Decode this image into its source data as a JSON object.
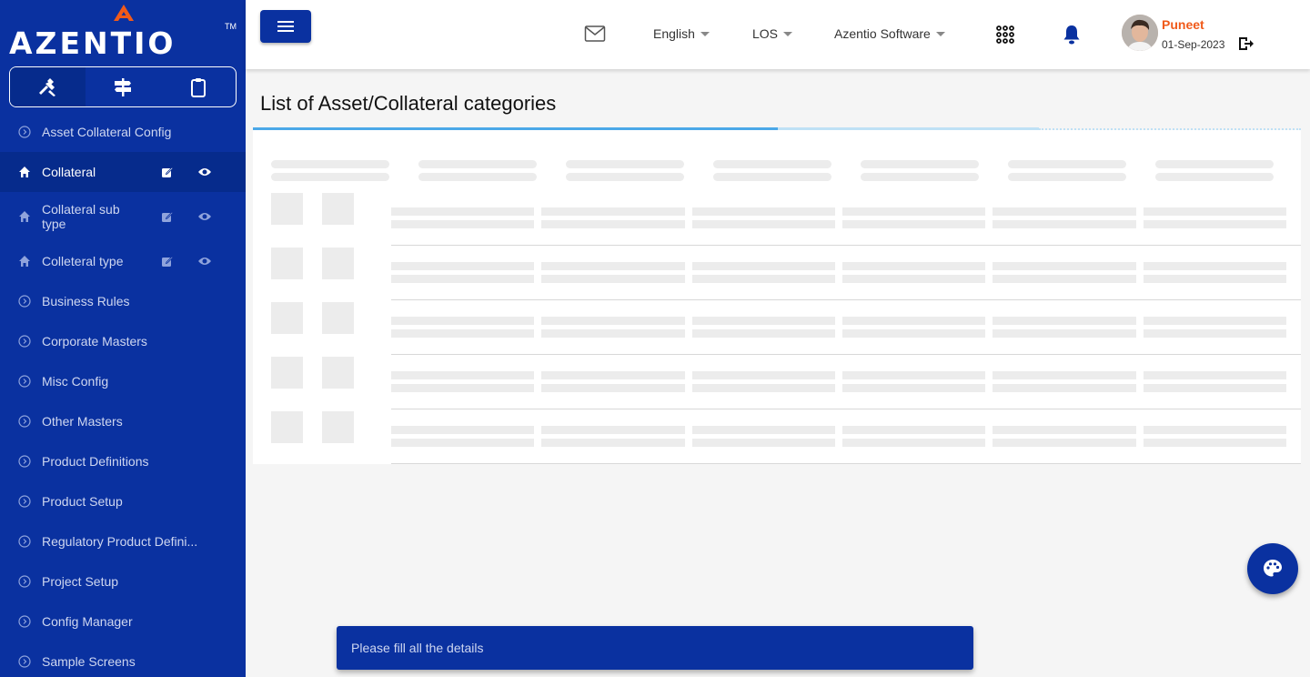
{
  "brand": {
    "logo_text": "AZENTIO",
    "trademark": "TM",
    "accent_color": "#f05a1a",
    "primary_color": "#0a31a0"
  },
  "sidebar": {
    "tabs": [
      {
        "icon": "tools-icon",
        "active": true
      },
      {
        "icon": "signpost-icon",
        "active": false
      },
      {
        "icon": "clipboard-icon",
        "active": false
      }
    ],
    "items": [
      {
        "label": "Asset Collateral Config",
        "icon": "circle-chevron-icon"
      },
      {
        "label": "Collateral",
        "icon": "home-icon",
        "active": true,
        "actions": [
          "edit-icon",
          "eye-icon"
        ]
      },
      {
        "label": "Collateral sub type",
        "icon": "home-icon",
        "actions": [
          "edit-icon",
          "eye-icon"
        ]
      },
      {
        "label": "Colleteral type",
        "icon": "home-icon",
        "actions": [
          "edit-icon",
          "eye-icon"
        ]
      },
      {
        "label": "Business Rules",
        "icon": "circle-chevron-icon"
      },
      {
        "label": "Corporate Masters",
        "icon": "circle-chevron-icon"
      },
      {
        "label": "Misc Config",
        "icon": "circle-chevron-icon"
      },
      {
        "label": "Other Masters",
        "icon": "circle-chevron-icon"
      },
      {
        "label": "Product Definitions",
        "icon": "circle-chevron-icon"
      },
      {
        "label": "Product Setup",
        "icon": "circle-chevron-icon"
      },
      {
        "label": "Regulatory Product Defini...",
        "icon": "circle-chevron-icon"
      },
      {
        "label": "Project Setup",
        "icon": "circle-chevron-icon"
      },
      {
        "label": "Config Manager",
        "icon": "circle-chevron-icon"
      },
      {
        "label": "Sample Screens",
        "icon": "circle-chevron-icon"
      }
    ]
  },
  "header": {
    "language": "English",
    "module": "LOS",
    "organization": "Azentio Software",
    "user": {
      "name": "Puneet",
      "date": "01-Sep-2023"
    }
  },
  "main": {
    "title": "List of Asset/Collateral categories",
    "loading": true
  },
  "snackbar": {
    "message": "Please fill all the details"
  }
}
